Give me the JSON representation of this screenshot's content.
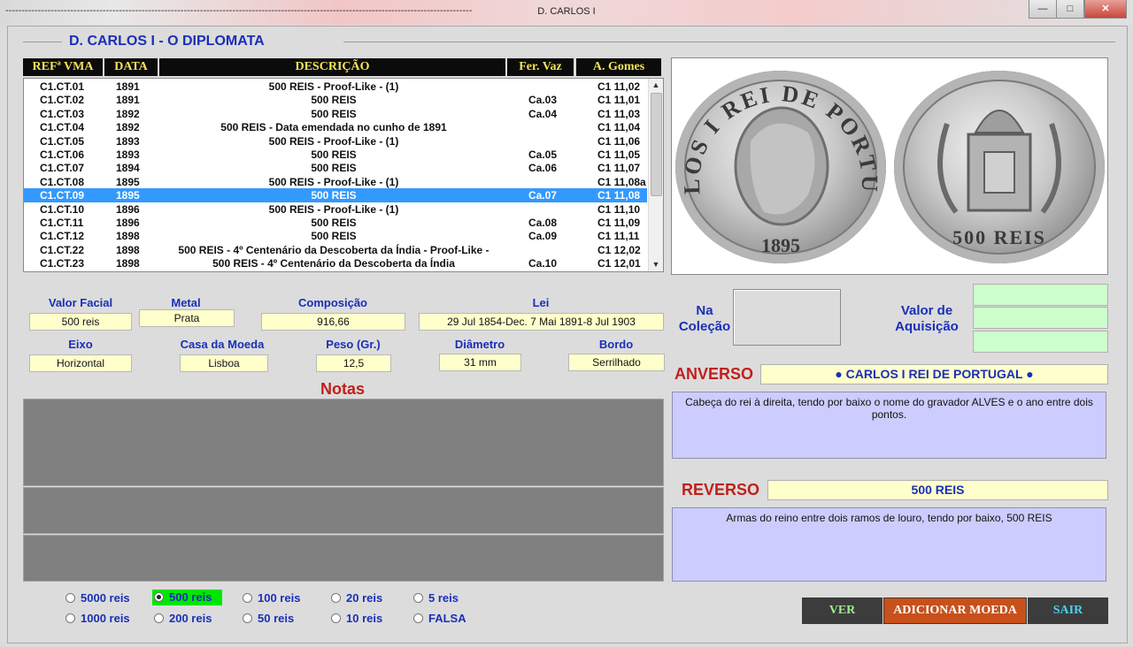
{
  "window": {
    "title": "D. CARLOS I",
    "dash_prefix": "------------------------------------------------------------------------------------------------------------------------------------------------",
    "minimize_glyph": "—",
    "maximize_glyph": "□",
    "close_glyph": "✕"
  },
  "header": {
    "title": "D. CARLOS I - O DIPLOMATA"
  },
  "table": {
    "columns": [
      "REFª  VMA",
      "DATA",
      "DESCRIÇÃO",
      "Fer. Vaz",
      "A. Gomes"
    ],
    "rows": [
      [
        "C1.CT.01",
        "1891",
        "500 REIS - Proof-Like - (1)",
        "",
        "C1 11,02"
      ],
      [
        "C1.CT.02",
        "1891",
        "500 REIS",
        "Ca.03",
        "C1 11,01"
      ],
      [
        "C1.CT.03",
        "1892",
        "500 REIS",
        "Ca.04",
        "C1 11,03"
      ],
      [
        "C1.CT.04",
        "1892",
        "500 REIS - Data emendada no cunho de 1891",
        "",
        "C1 11,04"
      ],
      [
        "C1.CT.05",
        "1893",
        "500 REIS - Proof-Like - (1)",
        "",
        "C1 11,06"
      ],
      [
        "C1.CT.06",
        "1893",
        "500 REIS",
        "Ca.05",
        "C1 11,05"
      ],
      [
        "C1.CT.07",
        "1894",
        "500 REIS",
        "Ca.06",
        "C1 11,07"
      ],
      [
        "C1.CT.08",
        "1895",
        "500 REIS - Proof-Like - (1)",
        "",
        "C1 11,08a"
      ],
      [
        "C1.CT.09",
        "1895",
        "500 REIS",
        "Ca.07",
        "C1 11,08"
      ],
      [
        "C1.CT.10",
        "1896",
        "500 REIS - Proof-Like - (1)",
        "",
        "C1 11,10"
      ],
      [
        "C1.CT.11",
        "1896",
        "500 REIS",
        "Ca.08",
        "C1 11,09"
      ],
      [
        "C1.CT.12",
        "1898",
        "500 REIS",
        "Ca.09",
        "C1 11,11"
      ],
      [
        "C1.CT.22",
        "1898",
        "500 REIS - 4º Centenário da Descoberta da Índia - Proof-Like -",
        "",
        "C1 12,02"
      ],
      [
        "C1.CT.23",
        "1898",
        "500 REIS - 4º Centenário da Descoberta da Índia",
        "Ca.10",
        "C1 12,01"
      ]
    ],
    "selected_row": 8,
    "scroll_up_glyph": "▲",
    "scroll_down_glyph": "▼"
  },
  "coin_image": {
    "obverse_legend": "CARLOS I REI DE PORTUGAL",
    "obverse_date": "1895",
    "reverse_legend": "500 REIS"
  },
  "fields": {
    "valor_facial": {
      "label": "Valor Facial",
      "value": "500 reis"
    },
    "metal": {
      "label": "Metal",
      "value": "Prata"
    },
    "composicao": {
      "label": "Composição",
      "value": "916,66"
    },
    "lei": {
      "label": "Lei",
      "value": "29 Jul 1854-Dec. 7 Mai 1891-8 Jul 1903"
    },
    "eixo": {
      "label": "Eixo",
      "value": "Horizontal"
    },
    "casa_moeda": {
      "label": "Casa da Moeda",
      "value": "Lisboa"
    },
    "peso": {
      "label": "Peso (Gr.)",
      "value": "12,5"
    },
    "diametro": {
      "label": "Diâmetro",
      "value": "31 mm"
    },
    "bordo": {
      "label": "Bordo",
      "value": "Serrilhado"
    }
  },
  "notas": {
    "title": "Notas"
  },
  "colecao": {
    "label_line1": "Na",
    "label_line2": "Coleção"
  },
  "aquisicao": {
    "label_line1": "Valor de",
    "label_line2": "Aquisição"
  },
  "anverso": {
    "label": "ANVERSO",
    "legend": "● CARLOS  I  REI DE PORTUGAL ●",
    "description": "Cabeça do rei à direita, tendo por baixo o nome do gravador ALVES e o ano entre dois pontos."
  },
  "reverso": {
    "label": "REVERSO",
    "legend": "500 REIS",
    "description": "Armas do reino entre dois ramos de louro, tendo por baixo,      500 REIS"
  },
  "radios": [
    {
      "label": "5000 reis",
      "checked": false
    },
    {
      "label": "500 reis",
      "checked": true
    },
    {
      "label": "100 reis",
      "checked": false
    },
    {
      "label": "20 reis",
      "checked": false
    },
    {
      "label": "5 reis",
      "checked": false
    },
    {
      "label": "1000 reis",
      "checked": false
    },
    {
      "label": "200 reis",
      "checked": false
    },
    {
      "label": "50 reis",
      "checked": false
    },
    {
      "label": "10 reis",
      "checked": false
    },
    {
      "label": "FALSA",
      "checked": false
    }
  ],
  "buttons": {
    "ver": "VER",
    "adicionar": "ADICIONAR  MOEDA",
    "sair": "SAIR"
  },
  "colors": {
    "label_blue": "#1a2fb8",
    "section_red": "#c0201a",
    "field_yellow": "#ffffcc",
    "desc_lavender": "#ccccff",
    "selection_blue": "#3399ff",
    "radio_selected_green": "#00e600",
    "btn_ver_text": "#9cf08a",
    "btn_adicionar_bg": "#c8501a",
    "btn_sair_text": "#4ed0f0"
  }
}
